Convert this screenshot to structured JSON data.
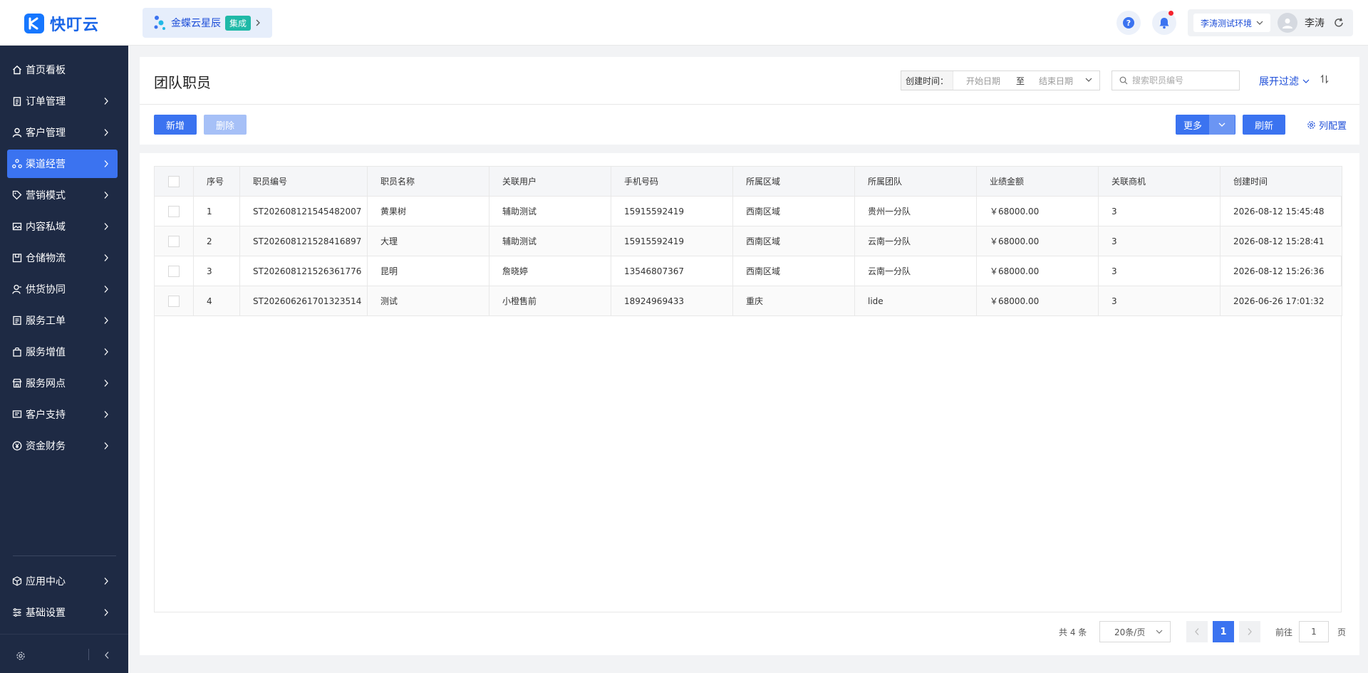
{
  "app": {
    "logo_text": "快叮云"
  },
  "header": {
    "brand": {
      "name": "金蝶云星辰",
      "tag": "集成"
    },
    "env_select": "李涛测试环境",
    "user_name": "李涛"
  },
  "sidebar": {
    "items": [
      {
        "label": "首页看板",
        "icon": "home-icon",
        "has_children": false,
        "active": false
      },
      {
        "label": "订单管理",
        "icon": "clipboard-icon",
        "has_children": true,
        "active": false
      },
      {
        "label": "客户管理",
        "icon": "user-icon",
        "has_children": true,
        "active": false
      },
      {
        "label": "渠道经营",
        "icon": "channel-icon",
        "has_children": true,
        "active": true
      },
      {
        "label": "营销模式",
        "icon": "tag-icon",
        "has_children": true,
        "active": false
      },
      {
        "label": "内容私域",
        "icon": "image-icon",
        "has_children": true,
        "active": false
      },
      {
        "label": "仓储物流",
        "icon": "box-icon",
        "has_children": true,
        "active": false
      },
      {
        "label": "供货协同",
        "icon": "supplier-icon",
        "has_children": true,
        "active": false
      },
      {
        "label": "服务工单",
        "icon": "ticket-icon",
        "has_children": true,
        "active": false
      },
      {
        "label": "服务增值",
        "icon": "bag-icon",
        "has_children": true,
        "active": false
      },
      {
        "label": "服务网点",
        "icon": "store-icon",
        "has_children": true,
        "active": false
      },
      {
        "label": "客户支持",
        "icon": "support-icon",
        "has_children": true,
        "active": false
      },
      {
        "label": "资金财务",
        "icon": "yen-icon",
        "has_children": true,
        "active": false
      }
    ],
    "bottom_items": [
      {
        "label": "应用中心",
        "icon": "cube-icon"
      },
      {
        "label": "基础设置",
        "icon": "sliders-icon"
      }
    ]
  },
  "page": {
    "title": "团队职员",
    "filter": {
      "date_label": "创建时间：",
      "start_placeholder": "开始日期",
      "range_sep": "至",
      "end_placeholder": "结束日期",
      "search_placeholder": "搜索职员编号",
      "expand_label": "展开过滤"
    },
    "toolbar": {
      "add_label": "新增",
      "delete_label": "删除",
      "more_label": "更多",
      "refresh_label": "刷新",
      "column_config_label": "列配置"
    }
  },
  "table": {
    "columns": [
      "序号",
      "职员编号",
      "职员名称",
      "关联用户",
      "手机号码",
      "所属区域",
      "所属团队",
      "业绩金额",
      "关联商机",
      "创建时间"
    ],
    "rows": [
      [
        "1",
        "ST202608121545482007",
        "黄果树",
        "辅助测试",
        "15915592419",
        "西南区域",
        "贵州一分队",
        "￥68000.00",
        "3",
        "2026-08-12 15:45:48"
      ],
      [
        "2",
        "ST202608121528416897",
        "大理",
        "辅助测试",
        "15915592419",
        "西南区域",
        "云南一分队",
        "￥68000.00",
        "3",
        "2026-08-12 15:28:41"
      ],
      [
        "3",
        "ST202608121526361776",
        "昆明",
        "詹晓婷",
        "13546807367",
        "西南区域",
        "云南一分队",
        "￥68000.00",
        "3",
        "2026-08-12 15:26:36"
      ],
      [
        "4",
        "ST202606261701323514",
        "测试",
        "小橙售前",
        "18924969433",
        "重庆",
        "lide",
        "￥68000.00",
        "3",
        "2026-06-26 17:01:32"
      ]
    ]
  },
  "pagination": {
    "total_text": "共 4 条",
    "page_size": "20条/页",
    "current_page": "1",
    "goto_label": "前往",
    "goto_value": "1",
    "goto_unit": "页"
  },
  "colors": {
    "primary": "#3b73f0",
    "sidebar_bg": "#1e2a44",
    "brand_tag": "#1fb9a7"
  }
}
